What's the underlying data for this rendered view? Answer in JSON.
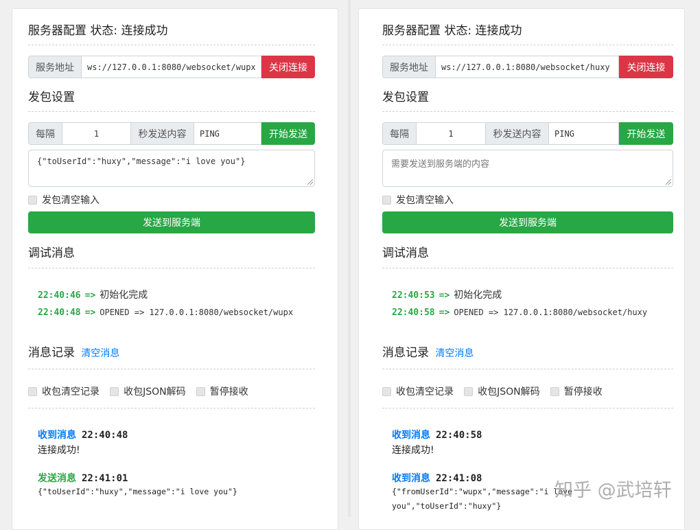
{
  "left": {
    "server_heading": "服务器配置 状态: 连接成功",
    "address_label": "服务地址",
    "address_value": "ws://127.0.0.1:8080/websocket/wupx",
    "close_button": "关闭连接",
    "send_heading": "发包设置",
    "interval_label": "每隔",
    "interval_value": "1",
    "content_label": "秒发送内容",
    "content_value": "PING",
    "start_button": "开始发送",
    "textarea_value": "{\"toUserId\":\"huxy\",\"message\":\"i love you\"}",
    "clear_input_label": "发包清空输入",
    "send_button": "发送到服务端",
    "debug_heading": "调试消息",
    "debug_logs": [
      {
        "time": "22:40:46",
        "arrow": "=>",
        "text": "初始化完成"
      },
      {
        "time": "22:40:48",
        "arrow": "=>",
        "text": "OPENED => 127.0.0.1:8080/websocket/wupx"
      }
    ],
    "record_heading": "消息记录",
    "clear_messages": "清空消息",
    "options": [
      "收包清空记录",
      "收包JSON解码",
      "暂停接收"
    ],
    "messages": [
      {
        "type": "收到消息",
        "time": "22:40:48",
        "lines": [
          "连接成功!"
        ]
      },
      {
        "type": "发送消息",
        "time": "22:41:01",
        "lines": [
          "{\"toUserId\":\"huxy\",\"message\":\"i love you\"}"
        ]
      }
    ]
  },
  "right": {
    "server_heading": "服务器配置 状态: 连接成功",
    "address_label": "服务地址",
    "address_value": "ws://127.0.0.1:8080/websocket/huxy",
    "close_button": "关闭连接",
    "send_heading": "发包设置",
    "interval_label": "每隔",
    "interval_value": "1",
    "content_label": "秒发送内容",
    "content_value": "PING",
    "start_button": "开始发送",
    "textarea_placeholder": "需要发送到服务端的内容",
    "clear_input_label": "发包清空输入",
    "send_button": "发送到服务端",
    "debug_heading": "调试消息",
    "debug_logs": [
      {
        "time": "22:40:53",
        "arrow": "=>",
        "text": "初始化完成"
      },
      {
        "time": "22:40:58",
        "arrow": "=>",
        "text": "OPENED => 127.0.0.1:8080/websocket/huxy"
      }
    ],
    "record_heading": "消息记录",
    "clear_messages": "清空消息",
    "options": [
      "收包清空记录",
      "收包JSON解码",
      "暂停接收"
    ],
    "messages": [
      {
        "type": "收到消息",
        "time": "22:40:58",
        "lines": [
          "连接成功!"
        ]
      },
      {
        "type": "收到消息",
        "time": "22:41:08",
        "lines": [
          "{\"fromUserId\":\"wupx\",\"message\":\"i love",
          "you\",\"toUserId\":\"huxy\"}"
        ]
      }
    ]
  },
  "watermark": "知乎 @武培轩",
  "colors": {
    "danger": "#dc3545",
    "success": "#28a745",
    "link": "#007bff"
  }
}
